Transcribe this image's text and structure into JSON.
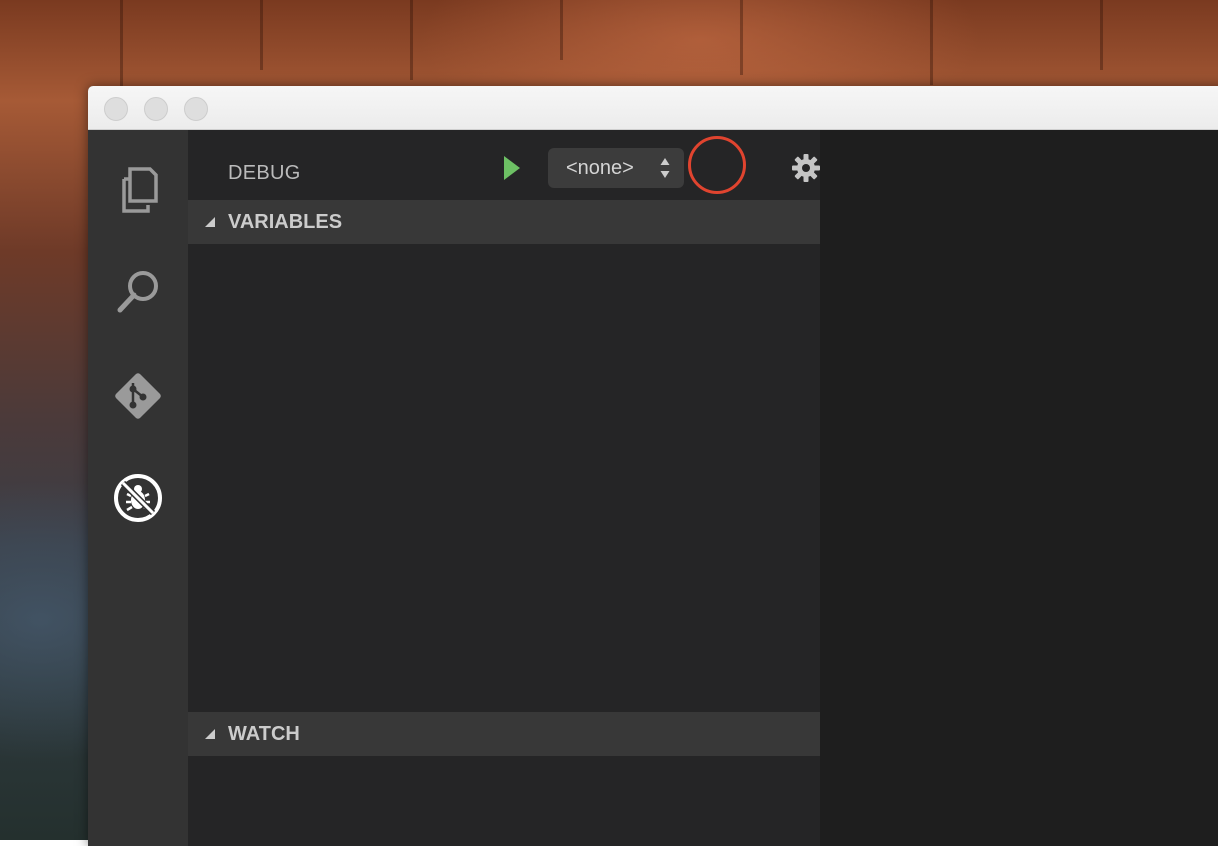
{
  "debug_view": {
    "title": "DEBUG",
    "start_button": "start-debugging",
    "configuration": {
      "selected": "<none>"
    },
    "settings_button": "configure-launch",
    "console_button": "open-debug-console"
  },
  "activity_bar": {
    "items": [
      {
        "icon": "files-icon"
      },
      {
        "icon": "search-icon"
      },
      {
        "icon": "git-icon"
      },
      {
        "icon": "debug-icon",
        "active": true
      }
    ]
  },
  "sections": {
    "variables": {
      "title": "VARIABLES",
      "expanded": true
    },
    "watch": {
      "title": "WATCH",
      "expanded": true
    }
  },
  "colors": {
    "start_green": "#6dc064",
    "highlight_red": "#e0442f",
    "sidebar_bg": "#252526",
    "activity_bg": "#333333",
    "section_header_bg": "#383838"
  }
}
